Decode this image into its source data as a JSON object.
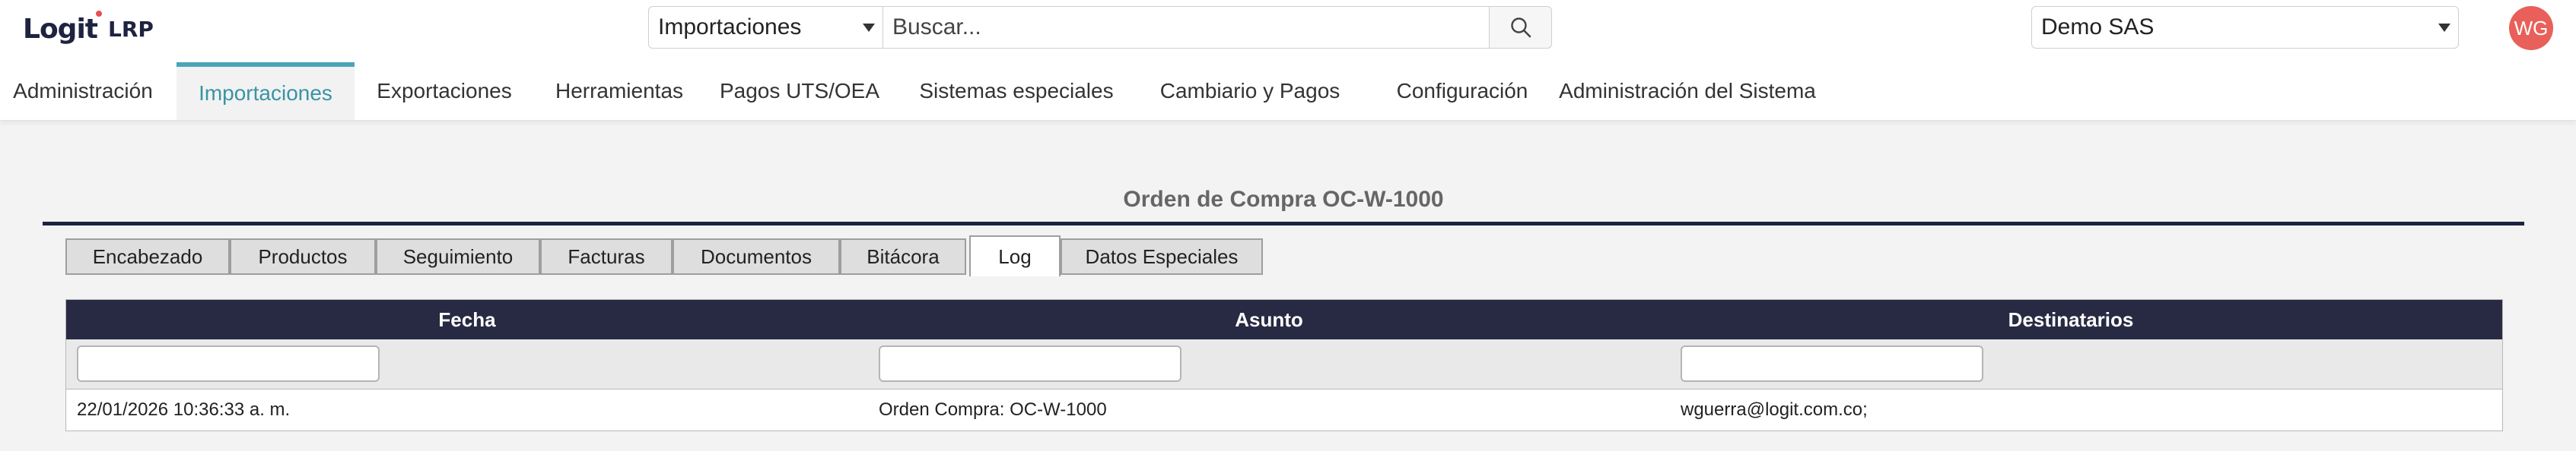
{
  "app": {
    "logo_text": "Logit",
    "logo_suffix": "LRP"
  },
  "topbar": {
    "module_select_value": "Importaciones",
    "search_placeholder": "Buscar...",
    "company_select_value": "Demo SAS",
    "avatar_initials": "WG"
  },
  "nav": {
    "items": [
      {
        "label": "Administración"
      },
      {
        "label": "Importaciones"
      },
      {
        "label": "Exportaciones"
      },
      {
        "label": "Herramientas"
      },
      {
        "label": "Pagos UTS/OEA"
      },
      {
        "label": "Sistemas especiales"
      },
      {
        "label": "Cambiario y Pagos"
      },
      {
        "label": "Configuración"
      },
      {
        "label": "Administración del Sistema"
      }
    ],
    "active_index": 1,
    "active_color": "#3a93a6"
  },
  "page": {
    "title": "Orden de Compra OC-W-1000"
  },
  "tabs": {
    "items": [
      {
        "label": "Encabezado"
      },
      {
        "label": "Productos"
      },
      {
        "label": "Seguimiento"
      },
      {
        "label": "Facturas"
      },
      {
        "label": "Documentos"
      },
      {
        "label": "Bitácora"
      },
      {
        "label": "Log"
      },
      {
        "label": "Datos Especiales"
      }
    ],
    "active_index": 6
  },
  "log_table": {
    "columns": [
      "Fecha",
      "Asunto",
      "Destinatarios"
    ],
    "filters": [
      "",
      "",
      ""
    ],
    "rows": [
      {
        "fecha": "22/01/2026 10:36:33 a. m.",
        "asunto": "Orden Compra: OC-W-1000",
        "destinatarios": "wguerra@logit.com.co;"
      }
    ]
  },
  "colors": {
    "header_bg": "#272a42",
    "avatar_bg": "#e9605a",
    "logo_dot": "#e8504d"
  }
}
